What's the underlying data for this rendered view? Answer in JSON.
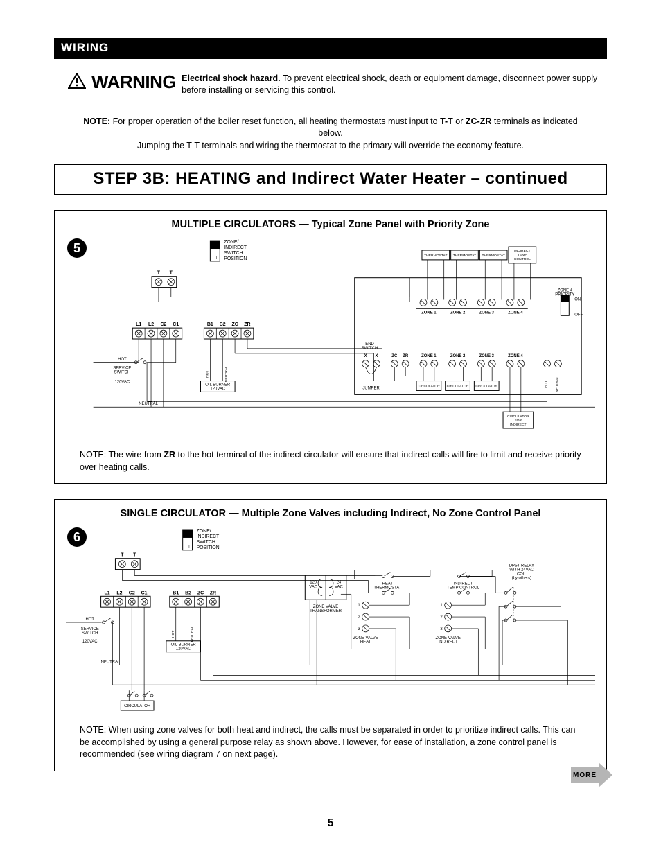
{
  "header": {
    "wiring": "WIRING"
  },
  "warning": {
    "word": "WARNING",
    "bold": "Electrical shock hazard.",
    "rest": " To prevent electrical shock, death or equipment damage, disconnect power supply before installing or servicing this control."
  },
  "note_top": {
    "prefix": "NOTE: ",
    "line1a": "For proper operation of the boiler reset function, all heating thermostats must input to ",
    "tt": "T-T",
    "or": " or ",
    "zczr": "ZC-ZR",
    "line1b": " terminals as indicated below.",
    "line2": "Jumping the T-T terminals and wiring the thermostat to the primary will override the economy feature."
  },
  "step_title": "STEP 3B:  HEATING and Indirect Water Heater – continued",
  "diagram5": {
    "number": "5",
    "title": "MULTIPLE CIRCULATORS — Typical Zone Panel with Priority Zone",
    "switch_label": "ZONE/\nINDIRECT\nSWITCH\nPOSITION",
    "tt_terminals": [
      "T",
      "T"
    ],
    "left_terminals": [
      "L1",
      "L2",
      "C2",
      "C1"
    ],
    "right_terminals": [
      "B1",
      "B2",
      "ZC",
      "ZR"
    ],
    "service_labels": {
      "hot": "HOT",
      "svc": "SERVICE\nSWITCH",
      "v120": "120VAC",
      "neutral": "NEUTRAL",
      "burner": "OIL BURNER\n120VAC",
      "hot2": "HOT",
      "neut2": "NEUTRAL"
    },
    "panel_top": [
      "THERMOSTAT",
      "THERMOSTAT",
      "THERMOSTAT",
      "INDIRECT\nTEMP\nCONTROL"
    ],
    "panel_zones": [
      "ZONE 1",
      "ZONE 2",
      "ZONE 3",
      "ZONE 4"
    ],
    "priority_label": "ZONE 4\nPRIORITY",
    "on_off": [
      "ON",
      "OFF"
    ],
    "end_switch": "END\nSWITCH",
    "bottom_terms": [
      "X",
      "X",
      "ZC",
      "ZR",
      "ZONE 1",
      "ZONE 2",
      "ZONE 3",
      "ZONE 4"
    ],
    "jumper": "JUMPER",
    "circ_labels": [
      "CIRCULATOR",
      "CIRCULATOR",
      "CIRCULATOR"
    ],
    "circ_indirect": "CIRCULATOR\nFOR\nINDIRECT",
    "hn": [
      "HOT",
      "NEUTRAL"
    ],
    "note_prefix": "NOTE: The wire from ",
    "note_zr": "ZR",
    "note_rest": " to the hot terminal of the indirect circulator will ensure that indirect calls will fire to limit and receive priority over heating calls."
  },
  "diagram6": {
    "number": "6",
    "title": "SINGLE CIRCULATOR — Multiple Zone Valves including Indirect, No Zone Control Panel",
    "switch_label": "ZONE/\nINDIRECT\nSWITCH\nPOSITION",
    "tt_terminals": [
      "T",
      "T"
    ],
    "left_terminals": [
      "L1",
      "L2",
      "C2",
      "C1"
    ],
    "right_terminals": [
      "B1",
      "B2",
      "ZC",
      "ZR"
    ],
    "service_labels": {
      "hot": "HOT",
      "svc": "SERVICE\nSWITCH",
      "v120": "120VAC",
      "neutral": "NEUTRAL",
      "burner": "OIL BURNER\n120VAC",
      "hot2": "HOT",
      "neut2": "NEUTRAL",
      "circ": "CIRCULATOR"
    },
    "xfmr_labels": [
      "120\nVAC",
      "24\nVAC",
      "ZONE VALVE\nTRANSFORMER"
    ],
    "heat_tstat": "HEAT\nTHERMOSTAT",
    "indirect_ctrl": "INDIRECT\nTEMP CONTROL",
    "dpst": "DPST RELAY\nWITH 24VAC\nCOIL\n(by others)",
    "zv_heat": "ZONE VALVE\nHEAT",
    "zv_indirect": "ZONE VALVE\nINDIRECT",
    "zv_nums": [
      "1",
      "2",
      "3"
    ],
    "note": "NOTE: When using zone valves for both heat and indirect, the calls must be separated in order to prioritize indirect calls. This can be accomplished by using a general purpose relay as shown above. However, for ease of installation, a zone control panel is recommended (see wiring diagram 7 on next page)."
  },
  "more": "MORE",
  "page_number": "5"
}
